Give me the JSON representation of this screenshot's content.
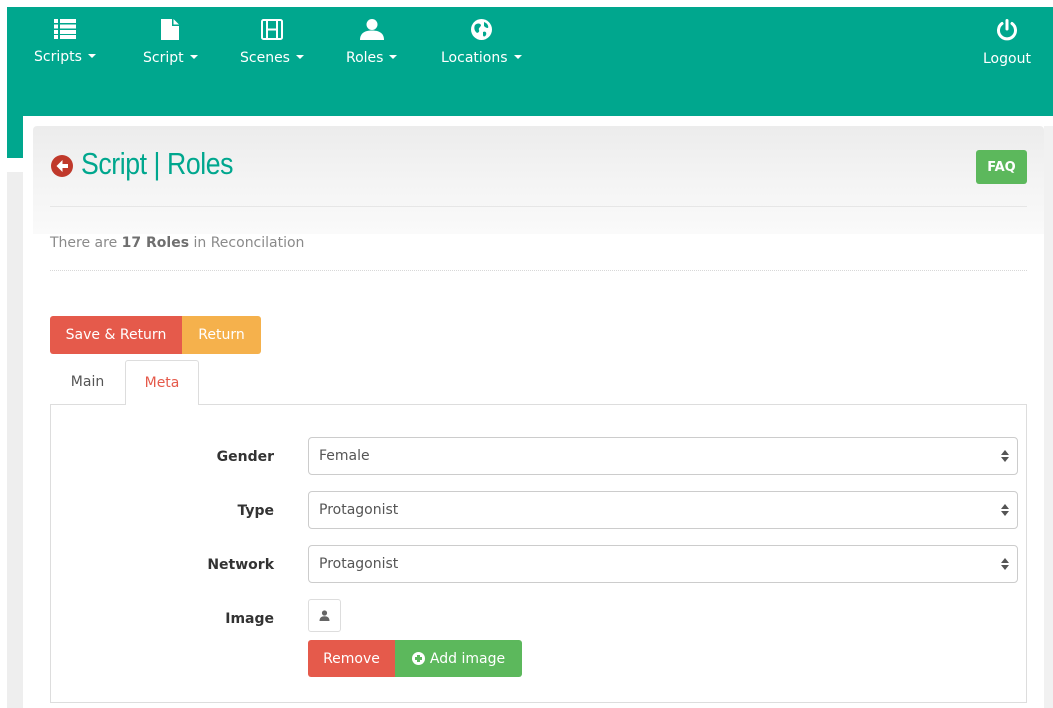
{
  "navbar": {
    "items": [
      {
        "label": "Scripts",
        "icon": "list-icon"
      },
      {
        "label": "Script",
        "icon": "document-icon"
      },
      {
        "label": "Scenes",
        "icon": "film-icon"
      },
      {
        "label": "Roles",
        "icon": "user-icon"
      },
      {
        "label": "Locations",
        "icon": "globe-icon"
      }
    ],
    "logout_label": "Logout"
  },
  "page": {
    "title": "Script | Roles",
    "faq_label": "FAQ",
    "info_prefix": "There are",
    "info_count": "17 Roles",
    "info_suffix": "in Reconcilation"
  },
  "actions": {
    "save_return_label": "Save & Return",
    "return_label": "Return"
  },
  "tabs": [
    {
      "label": "Main",
      "active": false
    },
    {
      "label": "Meta",
      "active": true
    }
  ],
  "form": {
    "gender": {
      "label": "Gender",
      "value": "Female"
    },
    "type": {
      "label": "Type",
      "value": "Protagonist"
    },
    "network": {
      "label": "Network",
      "value": "Protagonist"
    },
    "image": {
      "label": "Image"
    },
    "remove_label": "Remove",
    "add_image_label": "Add image"
  },
  "colors": {
    "brand": "#00a78e",
    "danger": "#e55a4b",
    "warning": "#f5b14c",
    "success": "#5cb85c",
    "back_icon": "#c0392b"
  }
}
